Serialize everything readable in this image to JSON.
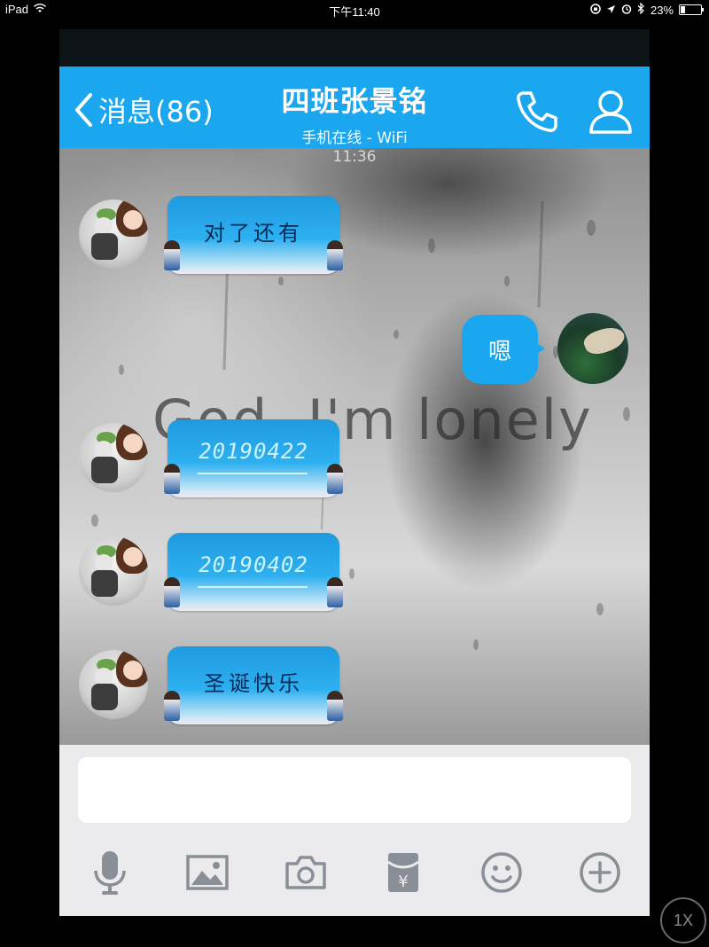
{
  "status_bar": {
    "device": "iPad",
    "time": "下午11:40",
    "battery_percent": "23%",
    "battery_level": 0.23
  },
  "header": {
    "back_label": "消息(86)",
    "title": "四班张景铭",
    "subtitle": "手机在线 - WiFi",
    "icons": [
      "chevron-left-icon",
      "phone-icon",
      "profile-icon"
    ]
  },
  "chat": {
    "timestamp": "11:36",
    "background_text": "God, I'm lonely",
    "messages": [
      {
        "sender": "other",
        "text": "对了还有",
        "style": "plain"
      },
      {
        "sender": "self",
        "text": "嗯"
      },
      {
        "sender": "other",
        "text": "20190422",
        "style": "date"
      },
      {
        "sender": "other",
        "text": "20190402",
        "style": "date"
      },
      {
        "sender": "other",
        "text": "圣诞快乐",
        "style": "plain"
      }
    ]
  },
  "input": {
    "value": "",
    "tools": [
      "microphone-icon",
      "image-icon",
      "camera-icon",
      "red-packet-icon",
      "emoji-icon",
      "plus-icon"
    ]
  },
  "zoom_label": "1X",
  "colors": {
    "accent": "#1aa7ef",
    "bubble_text": "#0a2a58",
    "input_bar_bg": "#ebebee"
  }
}
